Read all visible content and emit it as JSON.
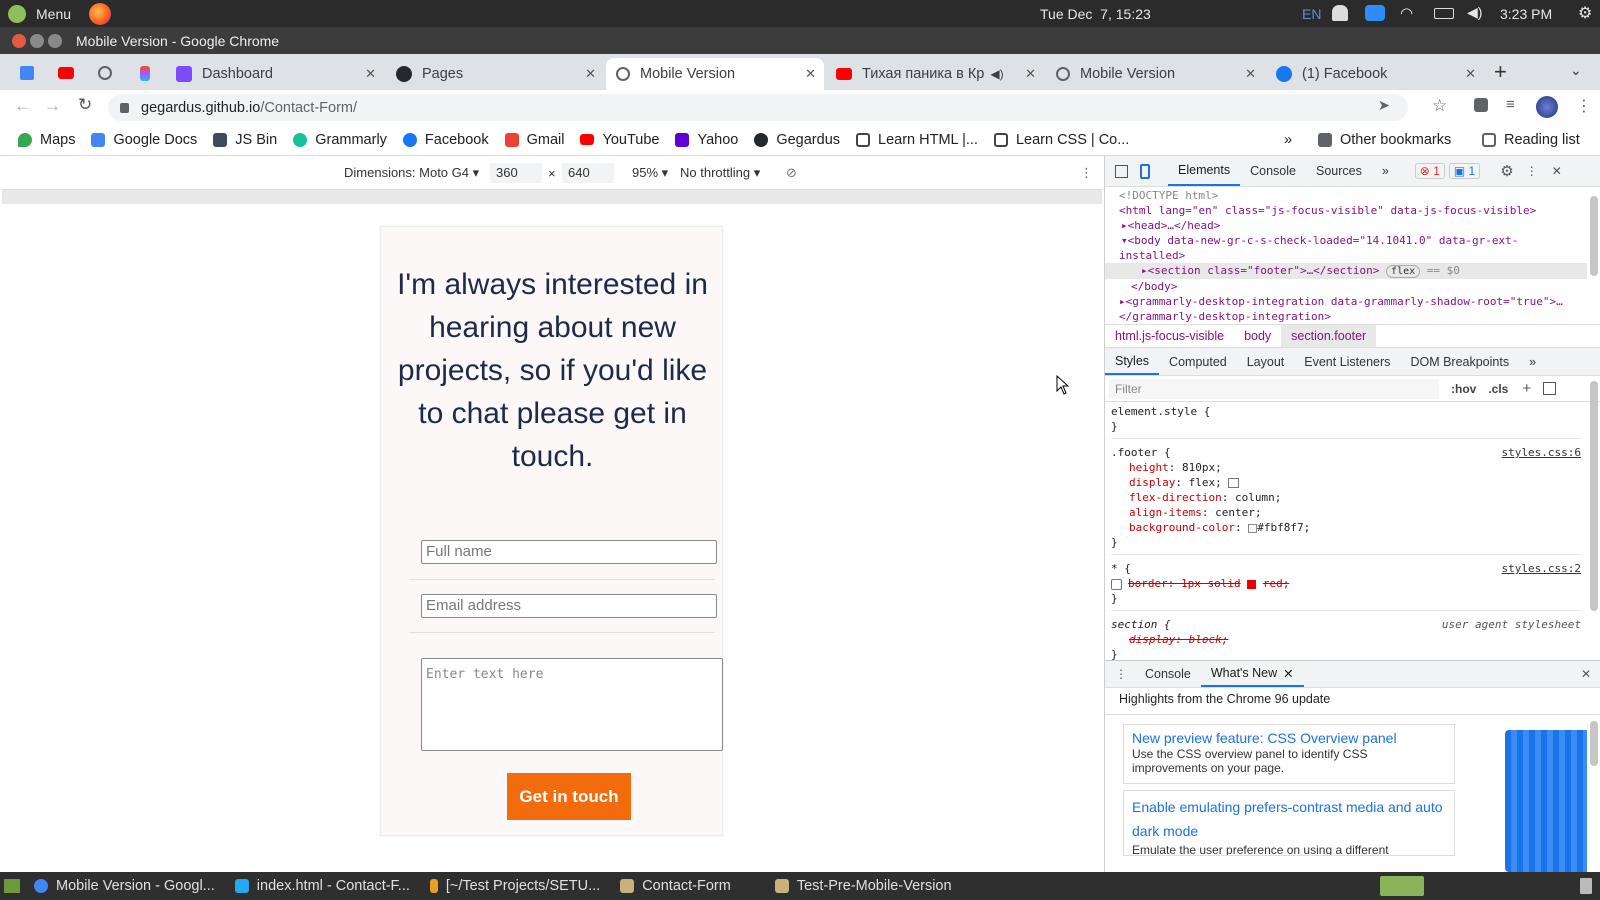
{
  "system_bar": {
    "menu_label": "Menu",
    "datetime": "Tue Dec  7, 15:23",
    "lang": "EN",
    "time": "3:23 PM"
  },
  "window": {
    "title": "Mobile Version - Google Chrome"
  },
  "tabs": [
    {
      "label": "Dashboard",
      "icon": "figma-dashboard-icon",
      "color": "#7b4dff"
    },
    {
      "label": "Pages",
      "icon": "github-icon",
      "color": "#24292e"
    },
    {
      "label": "Mobile Version",
      "icon": "globe-icon",
      "color": "#5f6368",
      "active": true
    },
    {
      "label": "Тихая паника в Кр",
      "icon": "youtube-icon",
      "color": "#ff0000"
    },
    {
      "label": "Mobile Version",
      "icon": "globe-icon",
      "color": "#5f6368"
    },
    {
      "label": "(1) Facebook",
      "icon": "facebook-icon",
      "color": "#1877f2"
    }
  ],
  "address": {
    "domain": "gegardus.github.io",
    "path": "/Contact-Form/"
  },
  "bookmarks": [
    {
      "label": "Maps",
      "icon": "maps-icon",
      "color": "#34a853"
    },
    {
      "label": "Google Docs",
      "icon": "docs-icon",
      "color": "#4285f4"
    },
    {
      "label": "JS Bin",
      "icon": "jsbin-icon",
      "color": "#3d4a5c"
    },
    {
      "label": "Grammarly",
      "icon": "grammarly-icon",
      "color": "#15c39a"
    },
    {
      "label": "Facebook",
      "icon": "facebook-icon",
      "color": "#1877f2"
    },
    {
      "label": "Gmail",
      "icon": "gmail-icon",
      "color": "#ea4335"
    },
    {
      "label": "YouTube",
      "icon": "youtube-icon",
      "color": "#ff0000"
    },
    {
      "label": "Yahoo",
      "icon": "yahoo-icon",
      "color": "#6001d2"
    },
    {
      "label": "Gegardus",
      "icon": "github-icon",
      "color": "#24292e"
    },
    {
      "label": "Learn HTML |...",
      "icon": "codecademy-icon",
      "color": "#444"
    },
    {
      "label": "Learn CSS | Co...",
      "icon": "codecademy-icon",
      "color": "#444"
    }
  ],
  "bookmarks_right": {
    "more": "»",
    "other": "Other bookmarks",
    "reading": "Reading list"
  },
  "device_toolbar": {
    "dimensions_label": "Dimensions: Moto G4",
    "width": "360",
    "times": "×",
    "height": "640",
    "zoom": "95%",
    "throttle": "No throttling"
  },
  "page": {
    "headline": "I'm always interested in hearing about new projects, so if you'd like to chat please get in touch.",
    "name_placeholder": "Full name",
    "email_placeholder": "Email address",
    "message_placeholder": "Enter text here",
    "cta": "Get in touch",
    "cta_color": "#f26c0d"
  },
  "devtools": {
    "tabs": [
      "Elements",
      "Console",
      "Sources",
      "»"
    ],
    "error_count": "1",
    "info_count": "1",
    "dom_lines": [
      "<!DOCTYPE html>",
      "<html lang=\"en\" class=\"js-focus-visible\" data-js-focus-visible>",
      "▸<head>…</head>",
      "▾<body data-new-gr-c-s-check-loaded=\"14.1041.0\" data-gr-ext-",
      "installed>",
      "▸<section class=\"footer\">…</section>",
      "flex",
      "== $0",
      "</body>",
      "▸<grammarly-desktop-integration data-grammarly-shadow-root=\"true\">…",
      "</grammarly-desktop-integration>"
    ],
    "breadcrumbs": [
      "html.js-focus-visible",
      "body",
      "section.footer"
    ],
    "style_tabs": [
      "Styles",
      "Computed",
      "Layout",
      "Event Listeners",
      "DOM Breakpoints",
      "»"
    ],
    "filter_placeholder": "Filter",
    "hov": ":hov",
    "cls": ".cls",
    "rules": {
      "element_style": "element.style {",
      "close": "}",
      "footer_selector": ".footer {",
      "footer_source": "styles.css:6",
      "footer_props": [
        {
          "name": "height",
          "value": "810px;"
        },
        {
          "name": "display",
          "value": "flex;"
        },
        {
          "name": "flex-direction",
          "value": "column;"
        },
        {
          "name": "align-items",
          "value": "center;"
        },
        {
          "name": "background-color",
          "value": "#fbf8f7;"
        }
      ],
      "star_selector": "* {",
      "star_source": "styles.css:2",
      "star_prop": "border: 1px solid",
      "star_prop_tail": "red;",
      "section_selector": "section {",
      "section_source": "user agent stylesheet",
      "section_prop": "display: block;"
    },
    "drawer_tabs": [
      "Console",
      "What's New"
    ],
    "whats_new_title": "Highlights from the Chrome 96 update",
    "card1_title": "New preview feature: CSS Overview panel",
    "card1_text": "Use the CSS overview panel to identify CSS improvements on your page.",
    "card2_title": "Enable emulating prefers-contrast media and auto dark mode",
    "card2_text": "Emulate the user preference on using a different"
  },
  "taskbar": [
    {
      "label": "Mobile Version - Googl...",
      "icon": "chrome-icon",
      "color": "#4285f4"
    },
    {
      "label": "index.html - Contact-F...",
      "icon": "vscode-icon",
      "color": "#23a9f2"
    },
    {
      "label": "[~/Test Projects/SETU...",
      "icon": "terminal-icon",
      "color": "#e8a020"
    },
    {
      "label": "Contact-Form",
      "icon": "folder-icon",
      "color": "#c9b27a"
    },
    {
      "label": "Test-Pre-Mobile-Version",
      "icon": "folder-icon",
      "color": "#c9b27a"
    }
  ]
}
